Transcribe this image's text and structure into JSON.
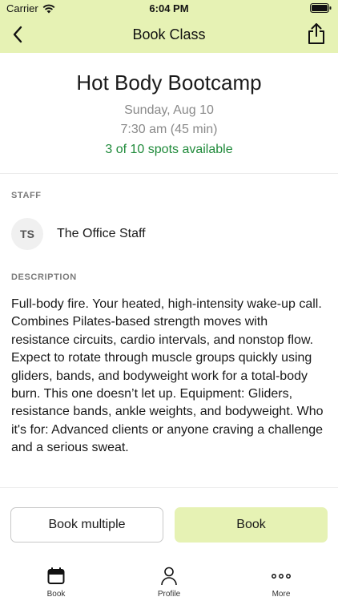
{
  "status_bar": {
    "carrier": "Carrier",
    "time": "6:04 PM"
  },
  "nav": {
    "title": "Book Class"
  },
  "class": {
    "name": "Hot Body Bootcamp",
    "date": "Sunday, Aug 10",
    "time": "7:30 am (45 min)",
    "spots": "3 of 10 spots available"
  },
  "staff": {
    "label": "STAFF",
    "initials": "TS",
    "name": "The Office Staff"
  },
  "description": {
    "label": "DESCRIPTION",
    "text": "Full-body fire. Your heated, high-intensity wake-up call. Combines Pilates-based strength moves with resistance circuits, cardio intervals, and nonstop flow. Expect to rotate through muscle groups quickly using gliders, bands, and bodyweight work for a total-body burn. This one doesn’t let up. Equipment: Gliders, resistance bands, ankle weights, and bodyweight. Who it's for: Advanced clients or anyone craving a challenge and a serious sweat."
  },
  "actions": {
    "book_multiple": "Book multiple",
    "book": "Book"
  },
  "tabs": [
    {
      "label": "Book",
      "icon": "calendar-icon"
    },
    {
      "label": "Profile",
      "icon": "person-icon"
    },
    {
      "label": "More",
      "icon": "more-icon"
    }
  ],
  "colors": {
    "accent": "#e6f2b4",
    "spots_green": "#1f8a3a",
    "muted": "#8a8a8a"
  }
}
